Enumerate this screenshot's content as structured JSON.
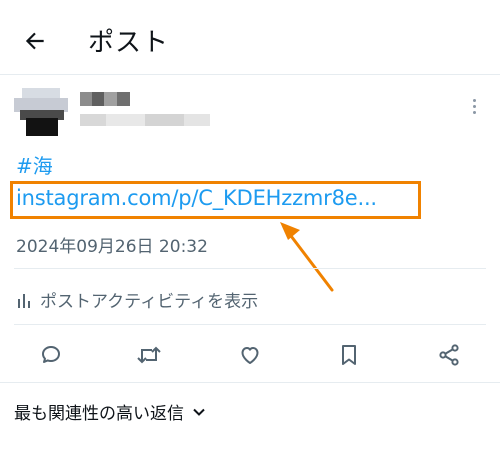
{
  "header": {
    "title": "ポスト"
  },
  "post": {
    "hashtag": "#海",
    "link_text": "instagram.com/p/C_KDEHzzmr8e...",
    "timestamp": "2024年09月26日 20:32",
    "activity_label": "ポストアクティビティを表示"
  },
  "actions": [
    "reply-icon",
    "repost-icon",
    "like-icon",
    "bookmark-icon",
    "share-icon"
  ],
  "replies": {
    "sort_label": "最も関連性の高い返信"
  },
  "colors": {
    "link": "#1d9bf0",
    "highlight": "#f08200",
    "muted": "#536471"
  }
}
